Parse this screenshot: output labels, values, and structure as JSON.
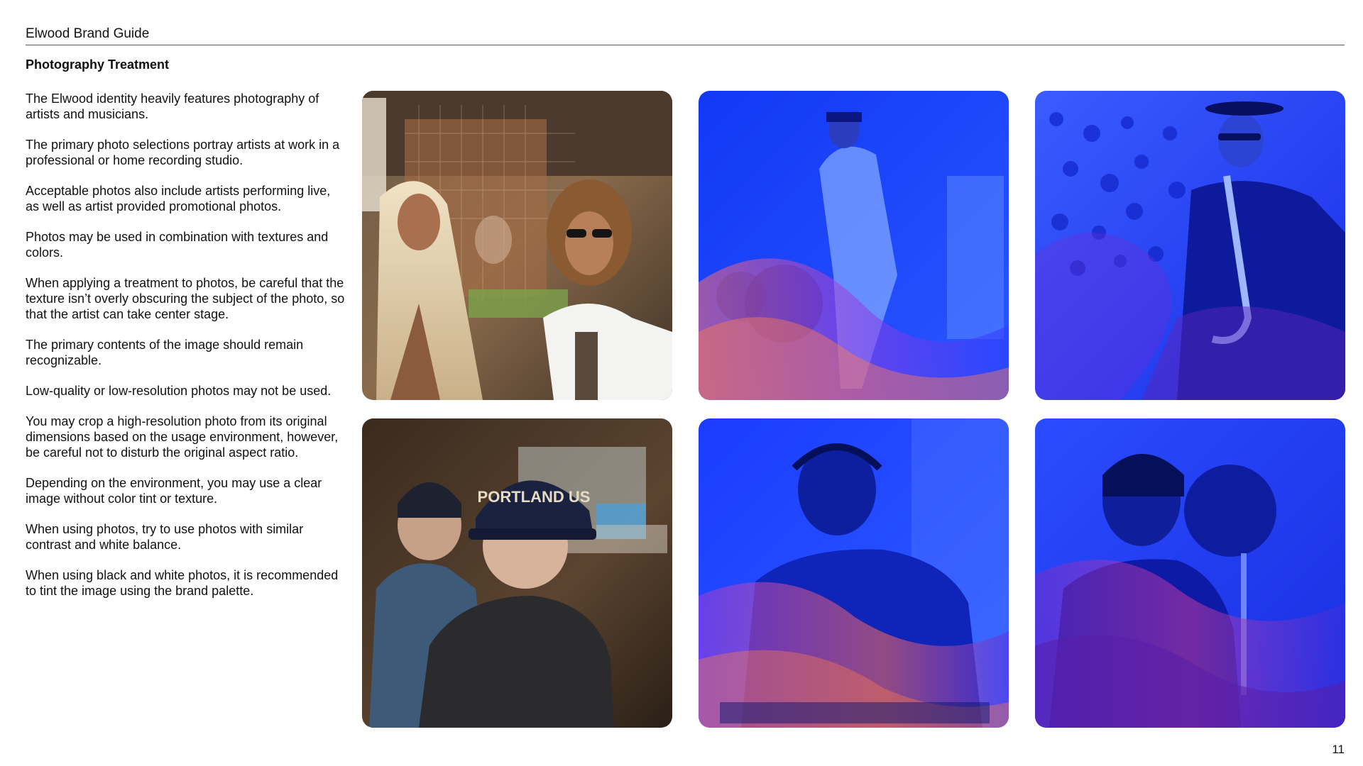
{
  "header": {
    "doc_title": "Elwood Brand Guide"
  },
  "section": {
    "title": "Photography Treatment"
  },
  "body": {
    "paragraphs": [
      "The Elwood identity heavily features photography of artists and musicians.",
      "The primary photo selections portray artists at work in a professional or home recording studio.",
      "Acceptable photos also include artists performing live, as well as artist provided promotional photos.",
      "Photos may be used in combination with textures and colors.",
      "When applying a treatment to photos, be careful that the texture isn’t overly obscuring the subject of the photo, so that the artist can take center stage.",
      "The primary contents of the image should remain recognizable.",
      "Low-quality or low-resolution photos may not be used.",
      "You may crop a high-resolution photo from its original dimensions based on the usage environment, however, be careful not to disturb the original aspect ratio.",
      "Depending on the environment, you may use a clear image without color tint or texture.",
      "When using photos, try to use photos with similar contrast and white balance.",
      "When using black and white photos, it is recommended to tint the image using the brand palette."
    ]
  },
  "photos": {
    "cap_text": "PORTLAND US",
    "tint_color": "#1f3dff"
  },
  "footer": {
    "page_number": "11"
  }
}
